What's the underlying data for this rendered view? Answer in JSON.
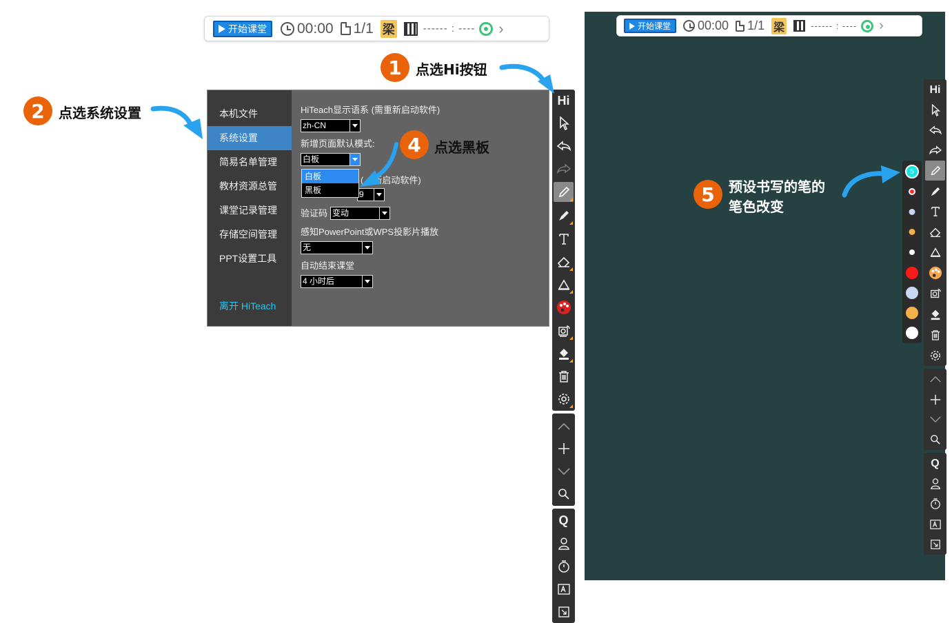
{
  "topbar": {
    "start_label": "开始课堂",
    "timer": "00:00",
    "pages": "1/1",
    "seat": "梁",
    "status_dashes": "------ : ----",
    "chevron": "›"
  },
  "settings": {
    "menu": [
      "本机文件",
      "系统设置",
      "简易名单管理",
      "教材资源总管",
      "课堂记录管理",
      "存储空间管理",
      "PPT设置工具"
    ],
    "active_index": 1,
    "leave": "离开 HiTeach",
    "lang_label": "HiTeach显示语系 (需重新启动软件)",
    "lang_value": "zh-CN",
    "mode_label": "新增页面默认模式:",
    "mode_value": "白板",
    "mode_options": [
      "白板",
      "黑板"
    ],
    "partial_label": "(",
    "partial_label_tail": "新启动软件)",
    "partial_value": "9",
    "verify_label": "验证码",
    "verify_value": "变动",
    "ppt_label": "感知PowerPoint或WPS投影片播放",
    "ppt_value": "无",
    "autoend_label": "自动结束课堂",
    "autoend_value": "4 小时后"
  },
  "annotations": {
    "a1": {
      "num": "1",
      "text": "点选Hi按钮"
    },
    "a2": {
      "num": "2",
      "text": "点选系统设置"
    },
    "a4": {
      "num": "4",
      "text": "点选黑板"
    },
    "a5": {
      "num": "5",
      "line1": "预设书写的笔的",
      "line2": "笔色改变"
    }
  },
  "toolbar": {
    "hi_label": "Hi",
    "q_label": "Q"
  },
  "palette": {
    "selected_number": "5",
    "colors": [
      "#19e3e3",
      "#ff2a2a",
      "#c9d7f5",
      "#f5b04a",
      "#ffffff",
      "#ff1a1a",
      "#c9d7f5",
      "#f5b04a",
      "#ffffff"
    ]
  },
  "accent_colors": {
    "badge": "#e8630a",
    "arrow": "#29a3ee",
    "board": "#254141",
    "start_button": "#1e88e5"
  }
}
